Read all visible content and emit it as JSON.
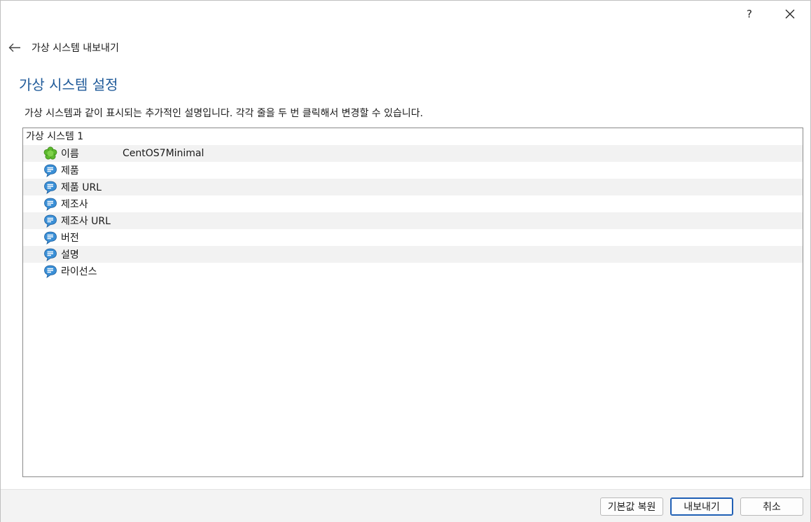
{
  "titlebar": {
    "help_label": "?"
  },
  "nav": {
    "title": "가상 시스템 내보내기"
  },
  "page": {
    "title": "가상 시스템 설정",
    "description": "가상 시스템과 같이 표시되는 추가적인 설명입니다. 각각 줄을 두 번 클릭해서 변경할 수 있습니다."
  },
  "tree": {
    "root": "가상 시스템 1",
    "rows": [
      {
        "icon": "name-icon",
        "label": "이름",
        "value": "CentOS7Minimal"
      },
      {
        "icon": "speech-bubble-icon",
        "label": "제품",
        "value": ""
      },
      {
        "icon": "speech-bubble-icon",
        "label": "제품 URL",
        "value": ""
      },
      {
        "icon": "speech-bubble-icon",
        "label": "제조사",
        "value": ""
      },
      {
        "icon": "speech-bubble-icon",
        "label": "제조사 URL",
        "value": ""
      },
      {
        "icon": "speech-bubble-icon",
        "label": "버전",
        "value": ""
      },
      {
        "icon": "speech-bubble-icon",
        "label": "설명",
        "value": ""
      },
      {
        "icon": "speech-bubble-icon",
        "label": "라이선스",
        "value": ""
      }
    ]
  },
  "footer": {
    "restore_label": "기본값 복원",
    "export_label": "내보내기",
    "cancel_label": "취소"
  },
  "colors": {
    "title_blue": "#1f5a99",
    "icon_blue": "#3a8fd6",
    "icon_green": "#5cb82e",
    "default_button_border": "#1f5fb5"
  }
}
